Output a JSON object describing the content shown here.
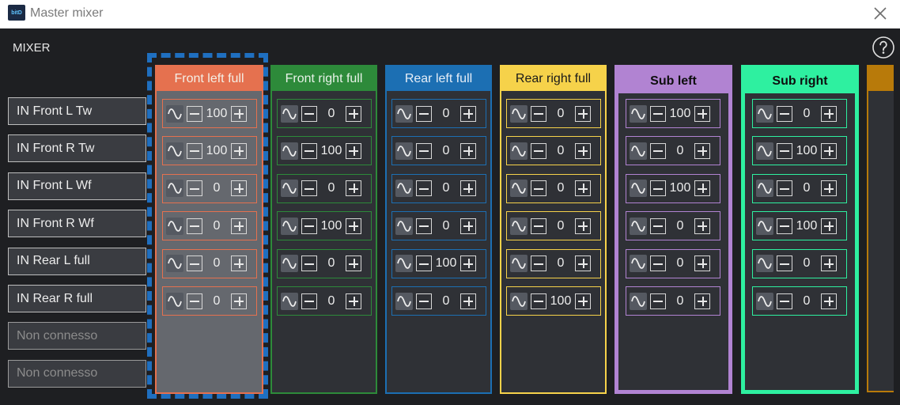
{
  "window": {
    "title": "Master mixer",
    "logo_text": "bitD"
  },
  "mixer_label": "MIXER",
  "inputs": [
    {
      "label": "IN Front L Tw",
      "connected": true
    },
    {
      "label": "IN Front R Tw",
      "connected": true
    },
    {
      "label": "IN Front L Wf",
      "connected": true
    },
    {
      "label": "IN Front R Wf",
      "connected": true
    },
    {
      "label": "IN Rear L full",
      "connected": true
    },
    {
      "label": "IN Rear R full",
      "connected": true
    },
    {
      "label": "Non connesso",
      "connected": false
    },
    {
      "label": "Non connesso",
      "connected": false
    }
  ],
  "outputs": [
    {
      "name": "Front left full",
      "color": "#e5714f",
      "header_text": "#f4efe6",
      "bold": false,
      "selected": true,
      "values": [
        100,
        100,
        0,
        0,
        0,
        0
      ]
    },
    {
      "name": "Front right full",
      "color": "#2d8a3a",
      "header_text": "#e8f2e8",
      "bold": false,
      "selected": false,
      "values": [
        0,
        100,
        0,
        100,
        0,
        0
      ]
    },
    {
      "name": "Rear left full",
      "color": "#1c6fb3",
      "header_text": "#e6eef7",
      "bold": false,
      "selected": false,
      "values": [
        0,
        0,
        0,
        0,
        100,
        0
      ]
    },
    {
      "name": "Rear right full",
      "color": "#f6d24a",
      "header_text": "#1a1a1a",
      "bold": false,
      "selected": false,
      "values": [
        0,
        0,
        0,
        0,
        0,
        100
      ]
    },
    {
      "name": "Sub left",
      "color": "#b183d2",
      "header_text": "#0e0e0e",
      "bold": true,
      "selected": false,
      "values": [
        100,
        0,
        100,
        0,
        0,
        0
      ]
    },
    {
      "name": "Sub right",
      "color": "#2ef0a0",
      "header_text": "#0e0e0e",
      "bold": true,
      "selected": false,
      "values": [
        0,
        100,
        0,
        100,
        0,
        0
      ]
    }
  ],
  "partial_column_color": "#b87a0a",
  "icons": {
    "close": "close-icon",
    "help": "help-icon",
    "wave": "sine-wave-icon",
    "minus": "minus-icon",
    "plus": "plus-icon"
  }
}
